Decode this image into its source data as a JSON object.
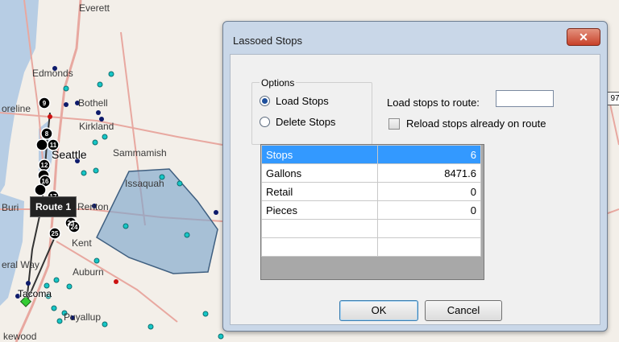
{
  "map": {
    "labels": [
      "Everett",
      "Edmonds",
      "oreline",
      "Bothell",
      "Kirkland",
      "Seattle",
      "Sammamish",
      "Issaquah",
      "Buri",
      "Renton",
      "Kent",
      "eral Way",
      "Auburn",
      "Tacoma",
      "Puyallup",
      "kewood"
    ],
    "highway": "97",
    "route_label": "Route 1",
    "stop_markers": [
      "9",
      "8",
      "11",
      "12",
      "16",
      "17",
      "23",
      "24",
      "25"
    ],
    "colors": {
      "lasso_fill": "#7ea6cc",
      "stop_cyan": "#16c6c6",
      "stop_navy": "#0d1a6b",
      "stop_red": "#cc1111",
      "road": "#e8a8a0"
    }
  },
  "dialog": {
    "title": "Lassoed Stops",
    "close_icon": "close-x",
    "options": {
      "legend": "Options",
      "load_stops": "Load Stops",
      "delete_stops": "Delete Stops",
      "selected": "Load Stops"
    },
    "load_to_route": {
      "label": "Load stops to route:",
      "value": ""
    },
    "reload": {
      "label": "Reload stops already on route",
      "checked": false
    },
    "grid": {
      "rows": [
        {
          "name": "Stops",
          "value": "6"
        },
        {
          "name": "Gallons",
          "value": "8471.6"
        },
        {
          "name": "Retail",
          "value": "0"
        },
        {
          "name": "Pieces",
          "value": "0"
        },
        {
          "name": "",
          "value": ""
        },
        {
          "name": "",
          "value": ""
        }
      ],
      "selected_row": 0
    },
    "ok_label": "OK",
    "cancel_label": "Cancel"
  }
}
